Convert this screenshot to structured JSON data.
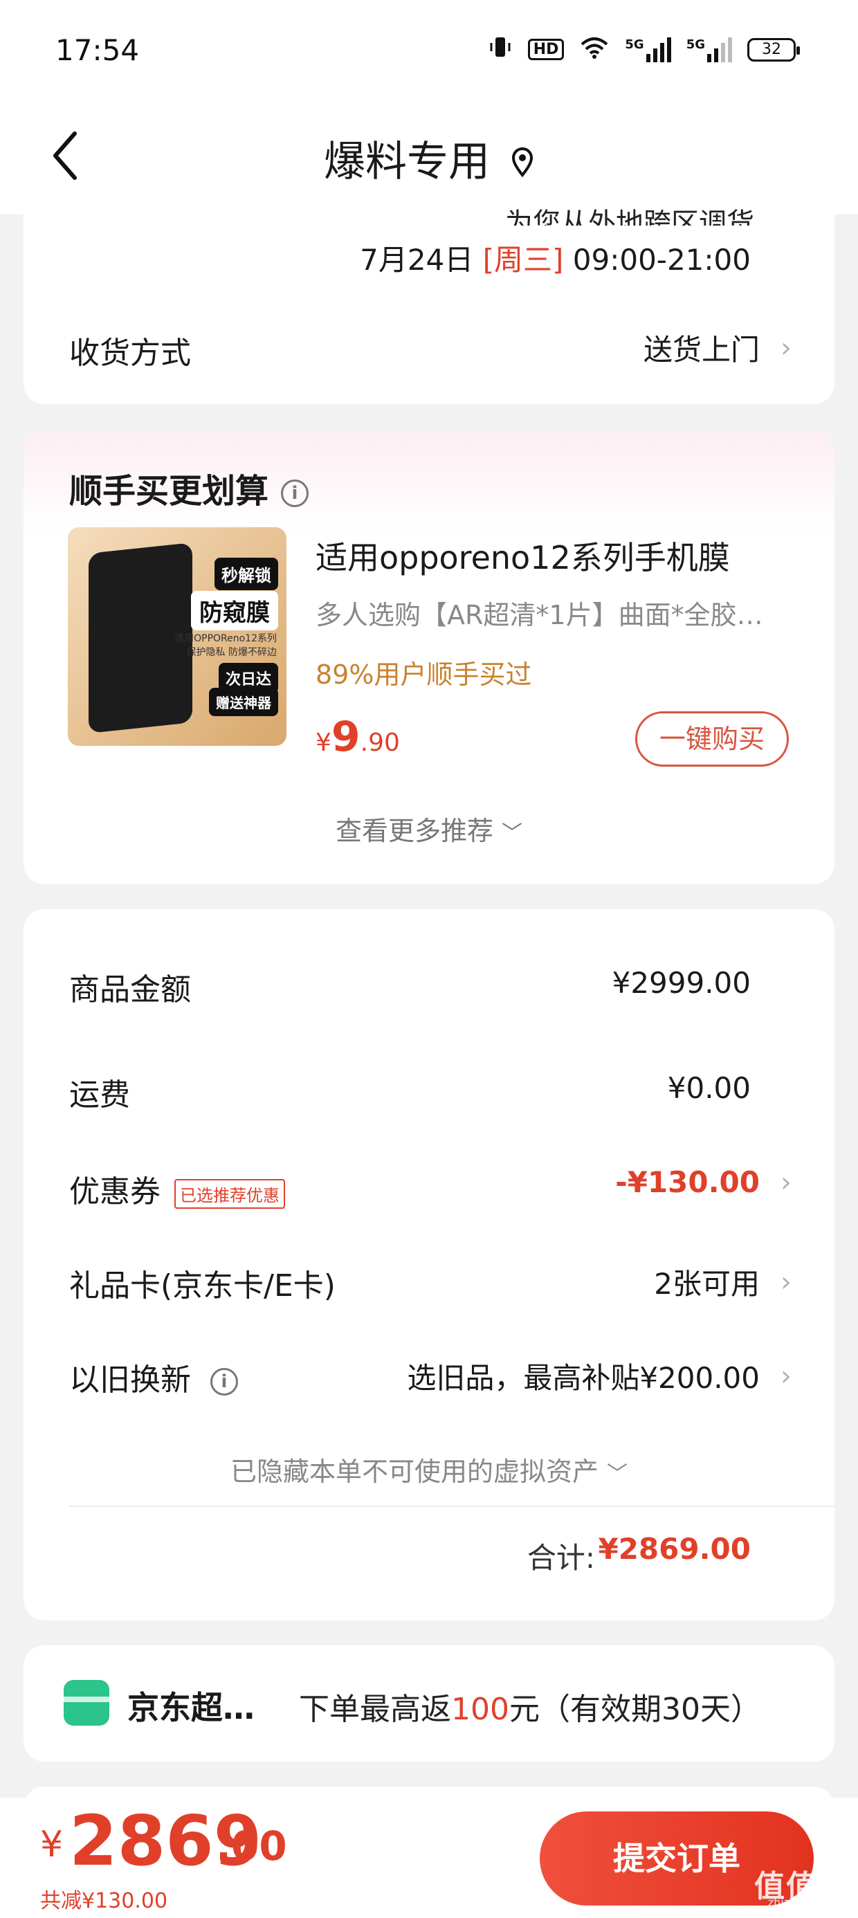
{
  "status_bar": {
    "time": "17:54",
    "hd": "HD",
    "net1": "5G",
    "net2": "5G",
    "battery": "32"
  },
  "header": {
    "title": "爆料专用"
  },
  "delivery": {
    "partial_text": "为您从外地跨区调货",
    "date_main": "7月24日 ",
    "date_weekday": "[周三]",
    "date_time": " 09:00-21:00",
    "method_label": "收货方式",
    "method_value": "送货上门"
  },
  "recommend": {
    "title": "顺手买更划算",
    "product": {
      "name": "适用opporeno12系列手机膜",
      "desc": "多人选购【AR超清*1片】曲面*全胶…",
      "hint": "89%用户顺手买过",
      "price_currency": "¥",
      "price_int": "9",
      "price_dec": ".90",
      "buy_label": "一键购买",
      "image_text": {
        "badge1": "秒解锁",
        "badge2": "防窥膜",
        "line1": "适用OPPOReno12系列",
        "line2": "保护隐私 防爆不碎边",
        "badge3": "次日达",
        "badge4": "赠送神器"
      }
    },
    "more_label": "查看更多推荐"
  },
  "amounts": {
    "rows": [
      {
        "label": "商品金额",
        "value": "¥2999.00"
      },
      {
        "label": "运费",
        "value": "¥0.00"
      },
      {
        "label": "优惠券",
        "tag": "已选推荐优惠",
        "value": "-¥130.00"
      },
      {
        "label": "礼品卡(京东卡/E卡)",
        "value": "2张可用"
      },
      {
        "label": "以旧换新",
        "value": "选旧品，最高补贴¥200.00"
      }
    ],
    "hidden_label": "已隐藏本单不可使用的虚拟资产",
    "total_label": "合计:",
    "total_value": "¥2869.00"
  },
  "jd": {
    "name": "京东超…",
    "text_pre": "下单最高返",
    "text_num": "100",
    "text_post": "元（有效期30天）"
  },
  "bottom": {
    "currency": "¥",
    "price_int": "2869",
    "price_dec": ".00",
    "saved": "共减¥130.00",
    "submit_label": "提交订单",
    "watermark": "值值值",
    "watermark_sub": "zhizhizhi.com"
  },
  "colors": {
    "accent": "#e0402a",
    "hint": "#c9822e",
    "green": "#2bc48a"
  }
}
